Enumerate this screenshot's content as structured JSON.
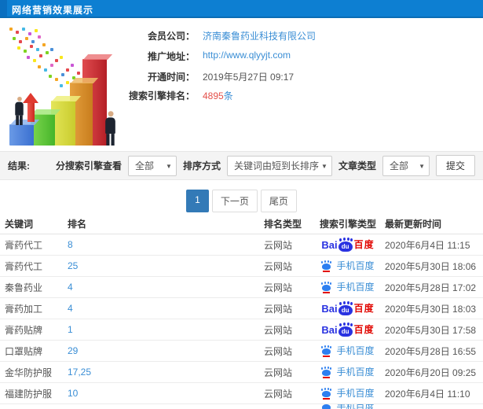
{
  "header": {
    "title": "网络营销效果展示"
  },
  "info": {
    "member_label": "会员公司：",
    "member_value": "济南秦鲁药业科技有限公司",
    "url_label": "推广地址：",
    "url_value": "http://www.qlyyjt.com",
    "open_label": "开通时间：",
    "open_value": "2019年5月27日 09:17",
    "rank_label": "搜索引擎排名：",
    "rank_value": "4895",
    "rank_unit": "条"
  },
  "filters": {
    "result_label": "结果:",
    "engine_label": "分搜索引擎查看",
    "engine_value": "全部",
    "sort_label": "排序方式",
    "sort_value": "关键词由短到长排序",
    "article_label": "文章类型",
    "article_value": "全部",
    "submit_label": "提交",
    "caret": "▼"
  },
  "pagination": {
    "current": "1",
    "next_label": "下一页",
    "last_label": "尾页"
  },
  "logos": {
    "baidu_pc": {
      "bai": "Bai",
      "du": "du",
      "cn": "百度"
    },
    "baidu_mobile": {
      "label": "手机百度"
    }
  },
  "table": {
    "headers": [
      "关键词",
      "排名",
      "排名类型",
      "搜索引擎类型",
      "最新更新时间"
    ],
    "rows": [
      {
        "keyword": "膏药代工",
        "rank": "8",
        "rank_type": "云网站",
        "engine": "百度",
        "time": "2020年6月4日 11:15"
      },
      {
        "keyword": "膏药代工",
        "rank": "25",
        "rank_type": "云网站",
        "engine": "手机百度",
        "time": "2020年5月30日 18:06"
      },
      {
        "keyword": "秦鲁药业",
        "rank": "4",
        "rank_type": "云网站",
        "engine": "手机百度",
        "time": "2020年5月28日 17:02"
      },
      {
        "keyword": "膏药加工",
        "rank": "4",
        "rank_type": "云网站",
        "engine": "百度",
        "time": "2020年5月30日 18:03"
      },
      {
        "keyword": "膏药贴牌",
        "rank": "1",
        "rank_type": "云网站",
        "engine": "百度",
        "time": "2020年5月30日 17:58"
      },
      {
        "keyword": "口罩贴牌",
        "rank": "29",
        "rank_type": "云网站",
        "engine": "手机百度",
        "time": "2020年5月28日 16:55"
      },
      {
        "keyword": "金华防护服",
        "rank": "17,25",
        "rank_type": "云网站",
        "engine": "手机百度",
        "time": "2020年6月20日 09:25"
      },
      {
        "keyword": "福建防护服",
        "rank": "10",
        "rank_type": "云网站",
        "engine": "手机百度",
        "time": "2020年6月4日 11:10"
      }
    ]
  },
  "colors": {
    "titlebar_blue": "#0d7fd2",
    "link_blue": "#3a8ed5",
    "accent_red": "#e4504a",
    "baidu_blue": "#2932e1",
    "baidu_red": "#e10601",
    "mobile_baidu_blue": "#2d7ff0",
    "pagination_active": "#337ab7",
    "filter_bar_bg": "#f4f4f4"
  }
}
